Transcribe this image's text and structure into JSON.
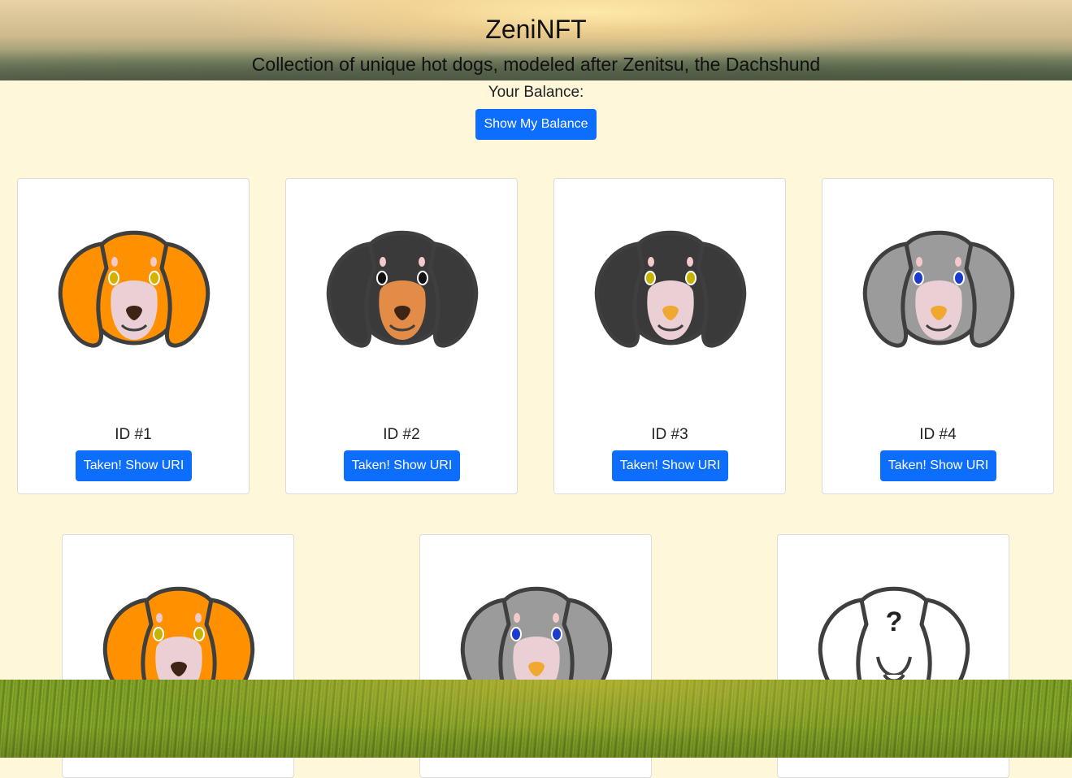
{
  "header": {
    "title": "ZeniNFT",
    "subtitle": "Collection of unique hot dogs, modeled after Zenitsu, the Dachshund"
  },
  "balance": {
    "label": "Your Balance:",
    "button_label": "Show My Balance"
  },
  "colors": {
    "primary_button": "#0d6efd",
    "page_background": "#fff7d9"
  },
  "cards": [
    {
      "id_label": "ID #1",
      "button_label": "Taken! Show URI",
      "icon": "orange-dachshund-icon",
      "fur": "#ff9100",
      "muzzle": "#ead0d4",
      "eye": "#d4b200",
      "nose": "#3d2414"
    },
    {
      "id_label": "ID #2",
      "button_label": "Taken! Show URI",
      "icon": "black-tan-dachshund-icon",
      "fur": "#3a3a3a",
      "muzzle": "#e38c47",
      "eye": "#111111",
      "nose": "#3d2414"
    },
    {
      "id_label": "ID #3",
      "button_label": "Taken! Show URI",
      "icon": "black-dachshund-icon",
      "fur": "#3a3a3a",
      "muzzle": "#ead0d4",
      "eye": "#c8b400",
      "nose": "#f0a830"
    },
    {
      "id_label": "ID #4",
      "button_label": "Taken! Show URI",
      "icon": "grey-dachshund-icon",
      "fur": "#9b9b9b",
      "muzzle": "#ead0d4",
      "eye": "#1a3ad0",
      "nose": "#f0a830"
    },
    {
      "icon": "orange-dachshund-icon",
      "fur": "#ff9100",
      "muzzle": "#ead0d4",
      "eye": "#c8b400",
      "nose": "#3d2414"
    },
    {
      "icon": "grey-dachshund-icon",
      "fur": "#9b9b9b",
      "muzzle": "#ead0d4",
      "eye": "#1a3ad0",
      "nose": "#f0a830"
    },
    {
      "icon": "unknown-dachshund-icon",
      "fur": "#ffffff",
      "muzzle": "#ffffff",
      "mystery": "?"
    }
  ]
}
